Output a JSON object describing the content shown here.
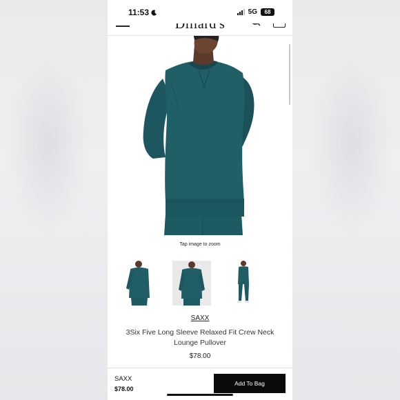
{
  "status_bar": {
    "time": "11:53",
    "network": "5G",
    "battery": "68"
  },
  "header": {
    "logo": "Dillard's",
    "icons": [
      "menu-icon",
      "search-icon",
      "shopping-bag-icon"
    ]
  },
  "product": {
    "zoom_hint": "Tap image to zoom",
    "brand": "SAXX",
    "title": "3Six Five Long Sleeve Relaxed Fit Crew Neck Lounge Pullover",
    "price": "$78.00",
    "thumbnail_count": 3,
    "selected_thumbnail": 2,
    "colors": {
      "garment": "#1f5c64",
      "background": "#ffffff"
    }
  },
  "bottom_bar": {
    "brand": "SAXX",
    "price": "$78.00",
    "add_to_bag_label": "Add To Bag"
  }
}
